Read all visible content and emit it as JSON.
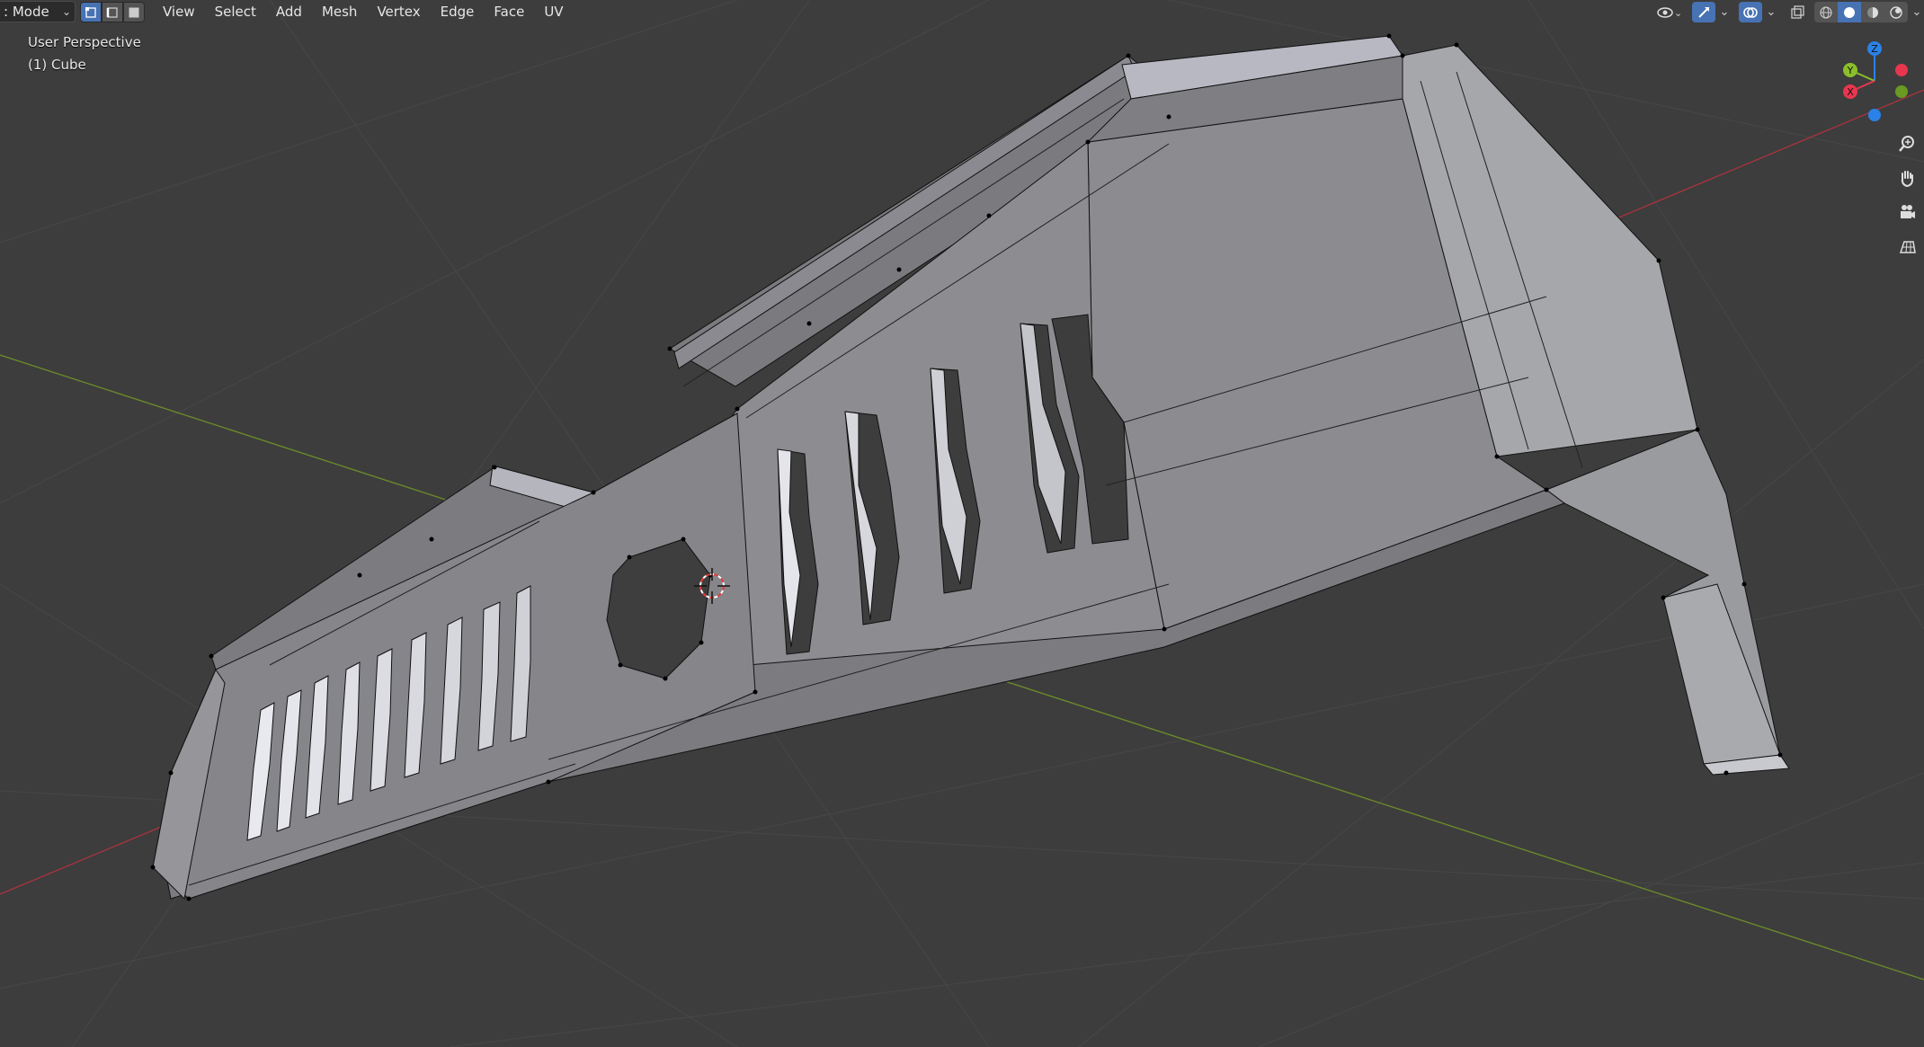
{
  "header": {
    "mode_label": ": Mode",
    "menu": [
      "View",
      "Select",
      "Add",
      "Mesh",
      "Vertex",
      "Edge",
      "Face",
      "UV"
    ]
  },
  "viewport": {
    "perspective_label": "User Perspective",
    "object_label": "(1) Cube"
  },
  "gizmo": {
    "z_label": "Z",
    "y_label": "Y",
    "x_label": "X"
  },
  "icons": [
    "select-vertex-icon",
    "select-edge-icon",
    "select-face-icon",
    "visibility-icon",
    "gizmo-icon",
    "overlay-icon",
    "xray-icon",
    "wireframe-shading-icon",
    "solid-shading-icon",
    "material-shading-icon",
    "rendered-shading-icon",
    "zoom-icon",
    "pan-hand-icon",
    "camera-icon",
    "ortho-grid-icon"
  ],
  "colors": {
    "background": "#3d3d3d",
    "accent": "#4772b3",
    "axis_x": "#e8364f",
    "axis_y": "#8bbf2a",
    "axis_z": "#2a82e8"
  }
}
